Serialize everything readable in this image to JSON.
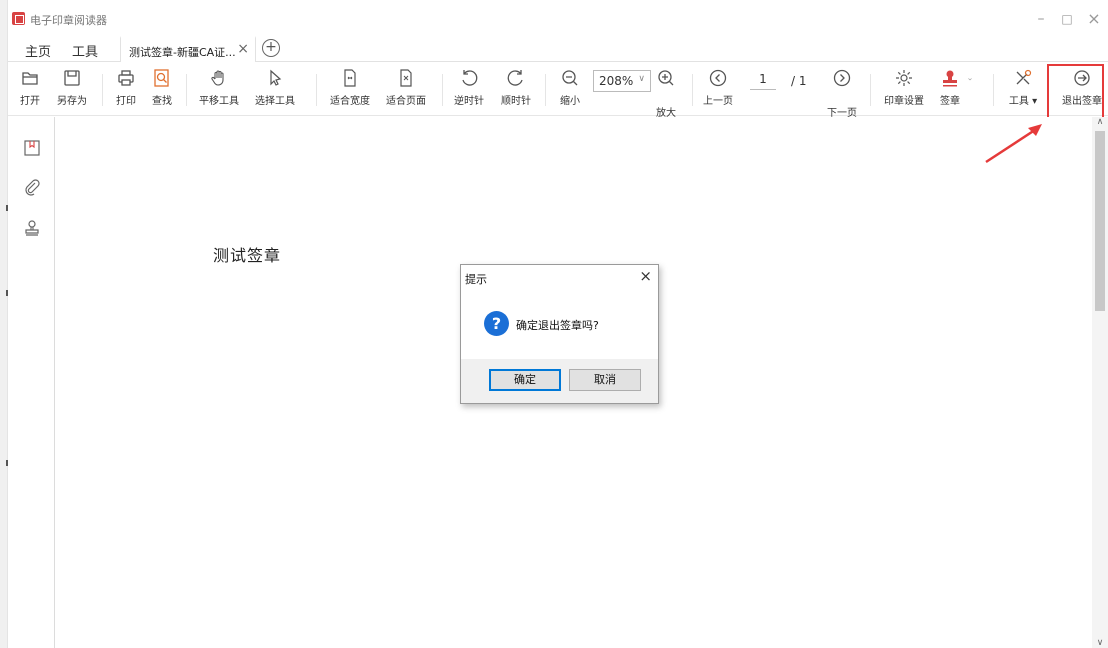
{
  "app": {
    "title": "电子印章阅读器"
  },
  "window_controls": {
    "minimize": "–",
    "maximize": "□",
    "close": "×"
  },
  "tabs": {
    "home": "主页",
    "tools": "工具",
    "document": "测试签章-新疆CA证...",
    "document_close": "×",
    "add": "+"
  },
  "toolbar": {
    "open": "打开",
    "save_as": "另存为",
    "print": "打印",
    "find": "查找",
    "pan": "平移工具",
    "select": "选择工具",
    "fit_width": "适合宽度",
    "fit_page": "适合页面",
    "rotate_ccw": "逆时针",
    "rotate_cw": "顺时针",
    "zoom_out": "缩小",
    "zoom_value": "208%",
    "zoom_in": "放大",
    "prev_page": "上一页",
    "current_page": "1",
    "total_pages": "/ 1",
    "next_page": "下一页",
    "seal_settings": "印章设置",
    "sign": "签章",
    "tools_menu": "工具 ▾",
    "exit_sign": "退出签章"
  },
  "document": {
    "text": "测试签章"
  },
  "dialog": {
    "title": "提示",
    "close": "×",
    "icon": "?",
    "message": "确定退出签章吗?",
    "ok": "确定",
    "cancel": "取消"
  },
  "colors": {
    "accent_red": "#e53a3a",
    "dialog_blue": "#1b6fd6",
    "seal_red": "#d84343"
  }
}
